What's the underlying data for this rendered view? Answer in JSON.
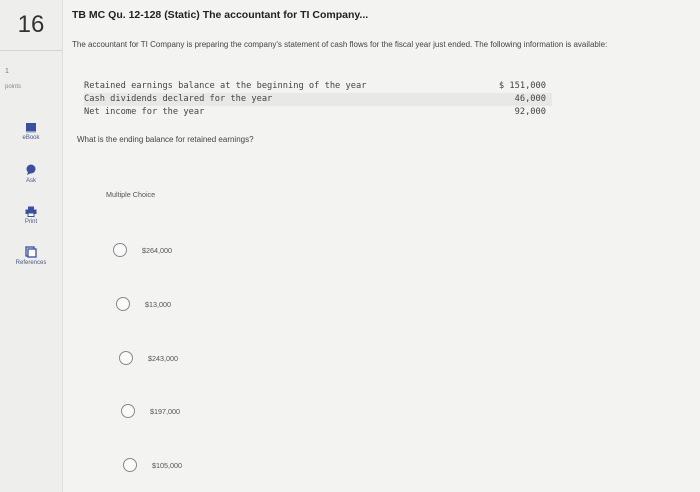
{
  "question": {
    "number": "16",
    "points_value": "1",
    "points_label": "points",
    "title": "TB MC Qu. 12-128 (Static) The accountant for TI Company...",
    "intro": "The accountant for TI Company is preparing the company's statement of cash flows for the fiscal year just ended. The following information is available:",
    "table": [
      {
        "label": "Retained earnings balance at the beginning of the year",
        "value": "$ 151,000"
      },
      {
        "label": "Cash dividends declared for the year",
        "value": "46,000"
      },
      {
        "label": "Net income for the year",
        "value": "92,000"
      }
    ],
    "prompt": "What is the ending balance for retained earnings?",
    "choices_label": "Multiple Choice",
    "choices": [
      "$264,000",
      "$13,000",
      "$243,000",
      "$197,000",
      "$105,000"
    ]
  },
  "tools": [
    {
      "label": "eBook",
      "icon": "ebook-icon"
    },
    {
      "label": "Ask",
      "icon": "chat-icon"
    },
    {
      "label": "Print",
      "icon": "print-icon"
    },
    {
      "label": "References",
      "icon": "references-icon"
    }
  ],
  "colors": {
    "accent": "#3b4fa0",
    "background": "#f3f3f1",
    "sidebar": "#eeeeec"
  }
}
